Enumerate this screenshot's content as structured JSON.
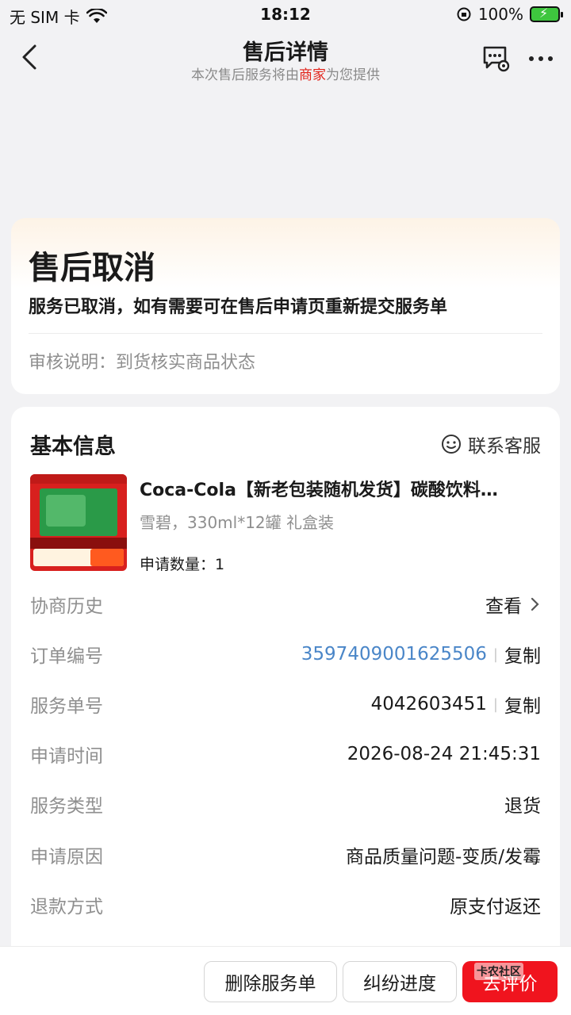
{
  "status_bar": {
    "carrier": "无 SIM 卡",
    "time": "18:12",
    "battery": "100%"
  },
  "nav": {
    "title": "售后详情",
    "subtitle_before": "本次售后服务将由",
    "subtitle_merchant": "商家",
    "subtitle_after": "为您提供"
  },
  "status": {
    "title": "售后取消",
    "description": "服务已取消，如有需要可在售后申请页重新提交服务单",
    "review_note": "审核说明：到货核实商品状态"
  },
  "info": {
    "title": "基本信息",
    "contact_label": "联系客服",
    "product": {
      "name": "Coca-Cola【新老包装随机发货】碳酸饮料…",
      "spec": "雪碧，330ml*12罐  礼盒装",
      "quantity": "申请数量：1"
    },
    "rows": [
      {
        "label": "协商历史",
        "value": "查看"
      },
      {
        "label": "订单编号",
        "value": "3597409001625506",
        "action": "复制"
      },
      {
        "label": "服务单号",
        "value": "4042603451",
        "action": "复制"
      },
      {
        "label": "申请时间",
        "value": "2026-08-24 21:45:31"
      },
      {
        "label": "服务类型",
        "value": "退货"
      },
      {
        "label": "申请原因",
        "value": "商品质量问题-变质/发霉"
      },
      {
        "label": "退款方式",
        "value": "原支付返还"
      }
    ]
  },
  "bottom": {
    "delete_label": "删除服务单",
    "dispute_label": "纠纷进度",
    "review_label": "去评价",
    "watermark": "卡农社区"
  },
  "colors": {
    "accent_red": "#f0141e",
    "link_blue": "#4a86c8",
    "merchant_red": "#e2231a"
  }
}
